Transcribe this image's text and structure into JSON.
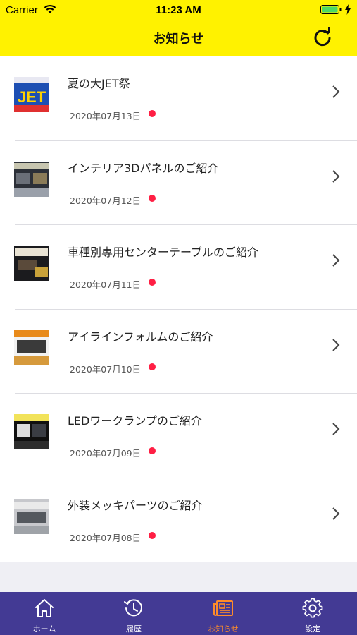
{
  "status": {
    "carrier": "Carrier",
    "time": "11:23 AM"
  },
  "header": {
    "title": "お知らせ",
    "refresh_icon": "refresh-icon"
  },
  "colors": {
    "accent": "#fff200",
    "tabbar": "#433a94",
    "active_tab": "#ff8c2a",
    "new_dot": "#ff1f44"
  },
  "news": [
    {
      "title": "夏の大JET祭",
      "date": "2020年07月13日",
      "unread": true,
      "thumb_text": "JET"
    },
    {
      "title": "インテリア3Dパネルのご紹介",
      "date": "2020年07月12日",
      "unread": true,
      "thumb_text": ""
    },
    {
      "title": "車種別専用センターテーブルのご紹介",
      "date": "2020年07月11日",
      "unread": true,
      "thumb_text": ""
    },
    {
      "title": "アイラインフォルムのご紹介",
      "date": "2020年07月10日",
      "unread": true,
      "thumb_text": ""
    },
    {
      "title": "LEDワークランプのご紹介",
      "date": "2020年07月09日",
      "unread": true,
      "thumb_text": ""
    },
    {
      "title": "外装メッキパーツのご紹介",
      "date": "2020年07月08日",
      "unread": true,
      "thumb_text": ""
    }
  ],
  "tabs": [
    {
      "label": "ホーム",
      "icon": "home-icon",
      "active": false
    },
    {
      "label": "履歴",
      "icon": "history-icon",
      "active": false
    },
    {
      "label": "お知らせ",
      "icon": "newspaper-icon",
      "active": true
    },
    {
      "label": "設定",
      "icon": "gear-icon",
      "active": false
    }
  ]
}
